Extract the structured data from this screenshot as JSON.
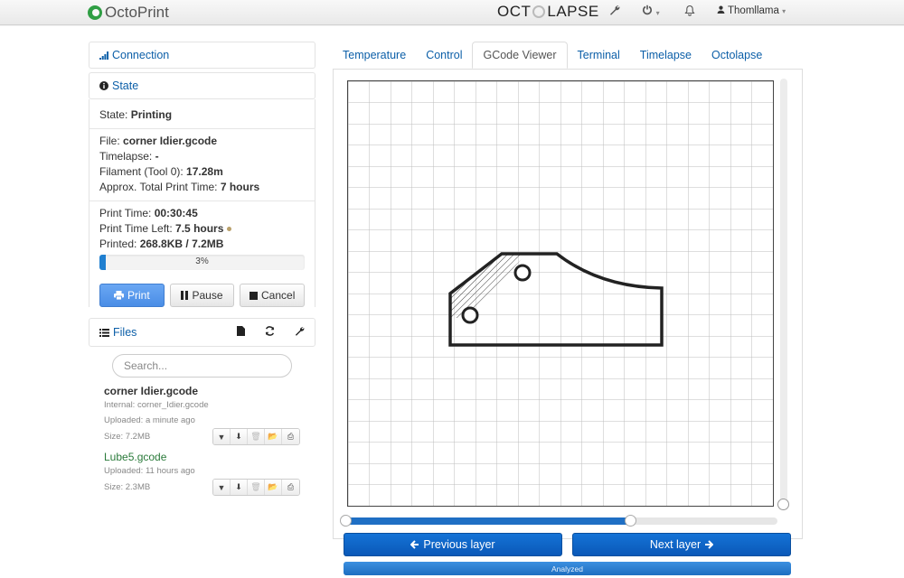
{
  "navbar": {
    "brand": "OctoPrint",
    "octolapse_left": "OCT",
    "octolapse_right": "LAPSE",
    "settings_icon": "wrench-icon",
    "power_icon": "power-icon",
    "power_caret": "▾",
    "notifications_icon": "bell-icon",
    "user": "Thomllama",
    "user_caret": "▾"
  },
  "sidebar": {
    "connection_label": "Connection",
    "state_label": "State",
    "state": {
      "state_key": "State:",
      "state_value": "Printing",
      "file_key": "File:",
      "file_value": "corner Idier.gcode",
      "timelapse_key": "Timelapse:",
      "timelapse_value": "-",
      "filament_key": "Filament (Tool 0):",
      "filament_value": "17.28m",
      "total_time_key": "Approx. Total Print Time:",
      "total_time_value": "7 hours",
      "print_time_key": "Print Time:",
      "print_time_value": "00:30:45",
      "time_left_key": "Print Time Left:",
      "time_left_value": "7.5 hours",
      "printed_key": "Printed:",
      "printed_value": "268.8KB / 7.2MB",
      "progress_label": "3%",
      "progress_fraction": 0.03
    },
    "buttons": {
      "print": "Print",
      "pause": "Pause",
      "cancel": "Cancel"
    },
    "files": {
      "label": "Files",
      "search_placeholder": "Search...",
      "items": [
        {
          "name": "corner Idier.gcode",
          "internal": "Internal: corner_Idier.gcode",
          "uploaded": "Uploaded: a minute ago",
          "size": "Size: 7.2MB"
        },
        {
          "name": "Lube5.gcode",
          "uploaded": "Uploaded: 11 hours ago",
          "size": "Size: 2.3MB"
        }
      ]
    }
  },
  "tabs": [
    {
      "label": "Temperature",
      "active": false
    },
    {
      "label": "Control",
      "active": false
    },
    {
      "label": "GCode Viewer",
      "active": true
    },
    {
      "label": "Terminal",
      "active": false
    },
    {
      "label": "Timelapse",
      "active": false
    },
    {
      "label": "Octolapse",
      "active": false
    }
  ],
  "viewer": {
    "layer_fraction": 0.66,
    "prev_layer": "Previous layer",
    "next_layer": "Next layer",
    "status": "Analyzed"
  },
  "colors": {
    "link": "#0c5fa8",
    "primary_button": "#4a8de6",
    "layer_button": "#0a58b8",
    "progress": "#1f7fd0",
    "part_outline": "#222222"
  }
}
